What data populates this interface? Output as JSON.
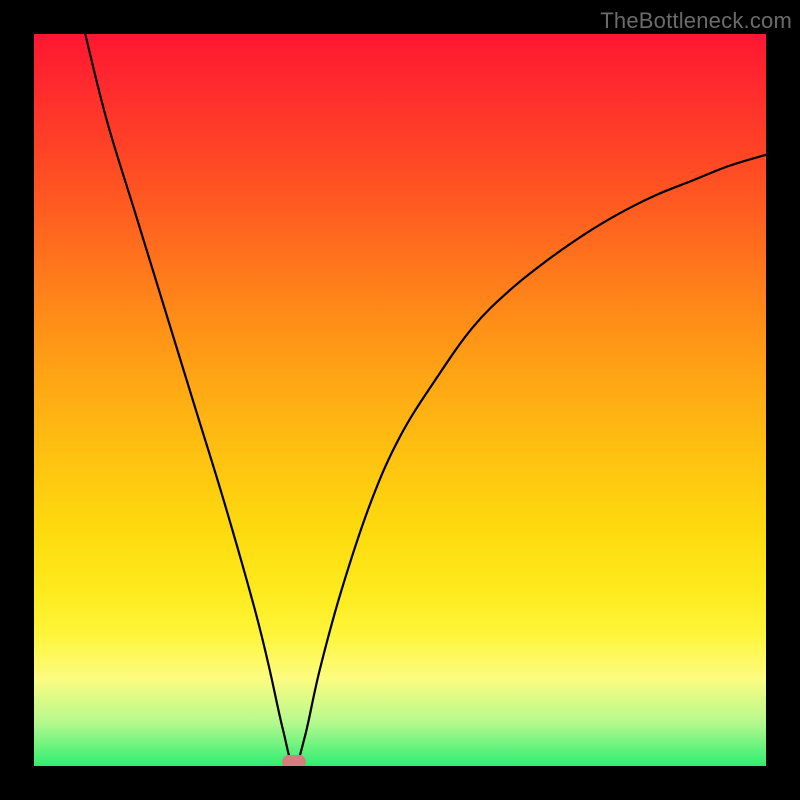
{
  "watermark": {
    "text": "TheBottleneck.com"
  },
  "chart_data": {
    "type": "line",
    "title": "",
    "xlabel": "",
    "ylabel": "",
    "xlim": [
      0,
      100
    ],
    "ylim": [
      0,
      100
    ],
    "grid": false,
    "legend": false,
    "background_gradient": {
      "orientation": "vertical",
      "stops": [
        {
          "pos": 0.0,
          "color": "#ff1730"
        },
        {
          "pos": 0.5,
          "color": "#ffa814"
        },
        {
          "pos": 0.8,
          "color": "#feea1d"
        },
        {
          "pos": 1.0,
          "color": "#2eee73"
        }
      ]
    },
    "series": [
      {
        "name": "bottleneck-curve",
        "color": "#000000",
        "x": [
          7,
          10,
          14,
          18,
          22,
          26,
          30,
          32,
          34,
          35.5,
          37,
          39,
          42,
          46,
          50,
          55,
          60,
          65,
          70,
          75,
          80,
          85,
          90,
          95,
          100
        ],
        "y": [
          100,
          88,
          75,
          62,
          49,
          36,
          22,
          14,
          5,
          0,
          4,
          13,
          24,
          36,
          45,
          53,
          60,
          65,
          69,
          72.5,
          75.5,
          78,
          80,
          82,
          83.5
        ]
      }
    ],
    "annotations": [
      {
        "name": "min-marker",
        "shape": "pill",
        "x": 35.5,
        "y": 0.5,
        "color": "#d57e7f"
      }
    ]
  }
}
